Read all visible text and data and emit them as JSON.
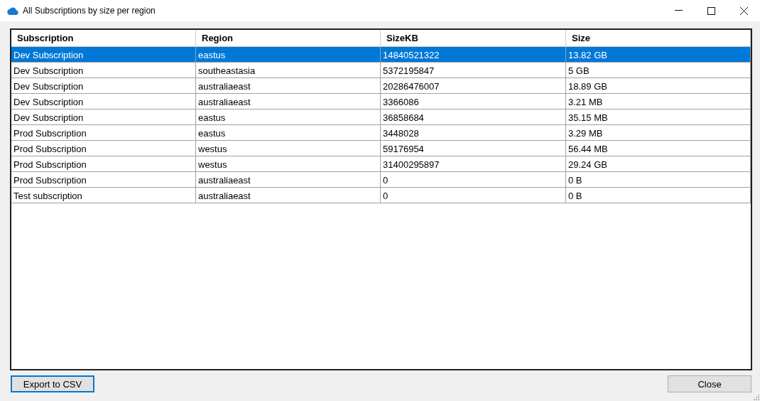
{
  "window": {
    "title": "All Subscriptions by size per region"
  },
  "table": {
    "columns": [
      "Subscription",
      "Region",
      "SizeKB",
      "Size"
    ],
    "rows": [
      {
        "cells": [
          "Dev Subscription",
          "eastus",
          "14840521322",
          "13.82 GB"
        ],
        "selected": true
      },
      {
        "cells": [
          "Dev Subscription",
          "southeastasia",
          "5372195847",
          "5 GB"
        ],
        "selected": false
      },
      {
        "cells": [
          "Dev Subscription",
          "australiaeast",
          "20286476007",
          "18.89 GB"
        ],
        "selected": false
      },
      {
        "cells": [
          "Dev Subscription",
          "australiaeast",
          "3366086",
          "3.21 MB"
        ],
        "selected": false
      },
      {
        "cells": [
          "Dev Subscription",
          "eastus",
          "36858684",
          "35.15 MB"
        ],
        "selected": false
      },
      {
        "cells": [
          "Prod Subscription",
          "eastus",
          "3448028",
          "3.29 MB"
        ],
        "selected": false
      },
      {
        "cells": [
          "Prod Subscription",
          "westus",
          "59176954",
          "56.44 MB"
        ],
        "selected": false
      },
      {
        "cells": [
          "Prod Subscription",
          "westus",
          "31400295897",
          "29.24 GB"
        ],
        "selected": false
      },
      {
        "cells": [
          "Prod Subscription",
          "australiaeast",
          "0",
          "0 B"
        ],
        "selected": false
      },
      {
        "cells": [
          "Test subscription",
          "australiaeast",
          "0",
          "0 B"
        ],
        "selected": false
      }
    ]
  },
  "buttons": [
    {
      "label": "Export to CSV",
      "focused": true
    },
    {
      "label": "Close",
      "focused": false
    }
  ]
}
